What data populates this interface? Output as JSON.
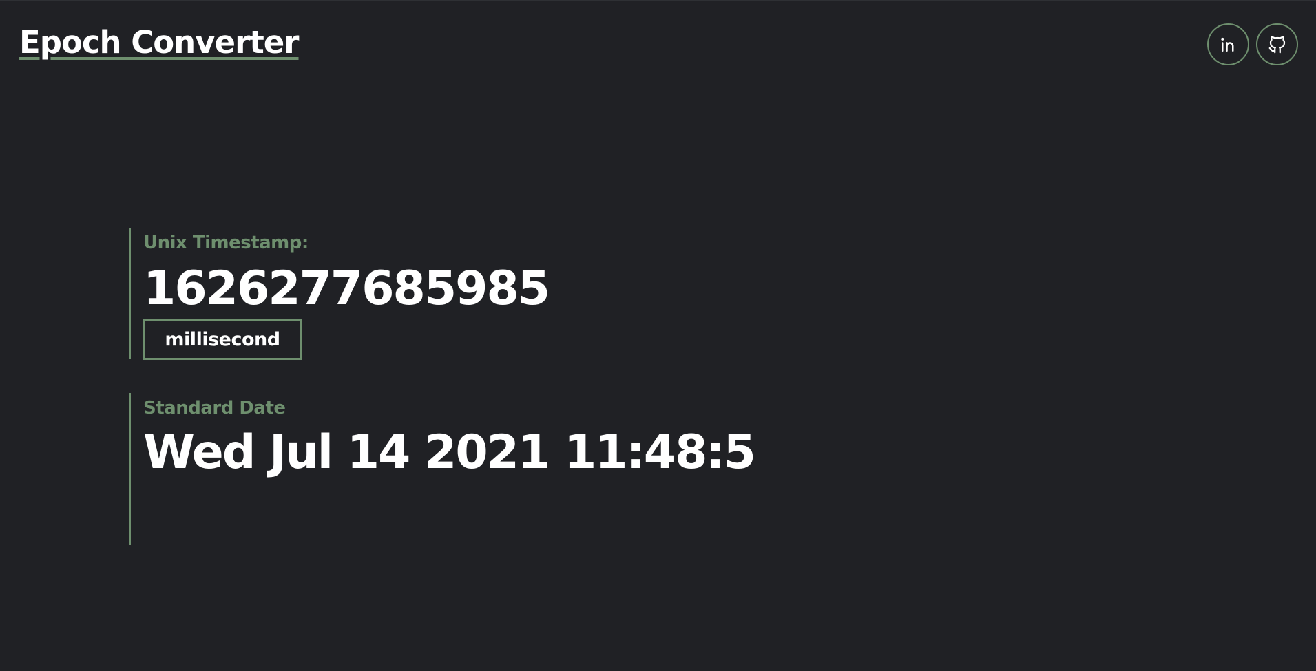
{
  "app": {
    "title": "Epoch Converter"
  },
  "header": {
    "social_links": [
      {
        "icon": "linkedin-icon"
      },
      {
        "icon": "github-icon"
      }
    ]
  },
  "timestamp_section": {
    "label": "Unix Timestamp:",
    "value": "1626277685985",
    "unit_button_label": "millisecond"
  },
  "date_section": {
    "label": "Standard Date",
    "value": "Wed Jul 14 2021 11:48:5"
  },
  "colors": {
    "background": "#202125",
    "accent": "#6e8f6e",
    "text": "#ffffff"
  }
}
